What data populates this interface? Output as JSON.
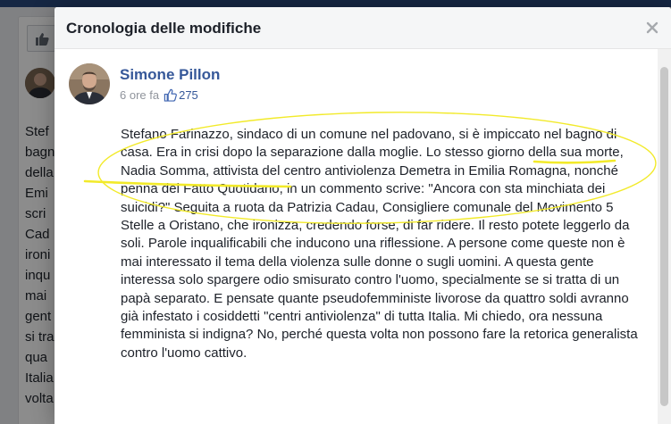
{
  "dialog": {
    "title": "Cronologia delle modifiche",
    "close_icon": "close-icon"
  },
  "post": {
    "author": "Simone Pillon",
    "time": "6 ore fa",
    "likes": "275",
    "paragraph": "Stefano Farinazzo, sindaco di un comune nel padovano, si è impiccato nel bagno di casa. Era in crisi dopo la separazione dalla moglie. Lo stesso giorno della sua morte, Nadia Somma, attivista del centro antiviolenza Demetra in Emilia Romagna, nonché penna del Fatto Quotidano, in un commento scrive: \"Ancora con sta minchiata dei suicidi?\" Seguita a ruota da Patrizia Cadau, Consigliere comunale del Movimento 5 Stelle a Oristano, che ironizza, credendo forse, di far ridere. Il resto potete leggerlo da soli. Parole inqualificabili che inducono una riflessione. A persone come queste non è mai interessato il tema della violenza sulle donne o sugli uomini. A questa gente interessa solo spargere odio smisurato contro l'uomo, specialmente se si tratta di un papà separato. E pensate quante pseudofemministe livorose da quattro soldi avranno già infestato i cosiddetti \"centri antiviolenza\" di tutta Italia. Mi chiedo, ora nessuna femminista si indigna? No, perché questa volta non possono fare la retorica generalista contro l'uomo cattivo."
  },
  "background": {
    "text_fragments": "Stef\nbagn\ndella\nEmi\nscri\nCad\nironi\ninqu\nmai\ngent\nsi tra\nqua\nItalia\nvolta"
  },
  "colors": {
    "link": "#365899",
    "annotation": "#f2ea2a",
    "header_bg": "#f5f6f7"
  }
}
